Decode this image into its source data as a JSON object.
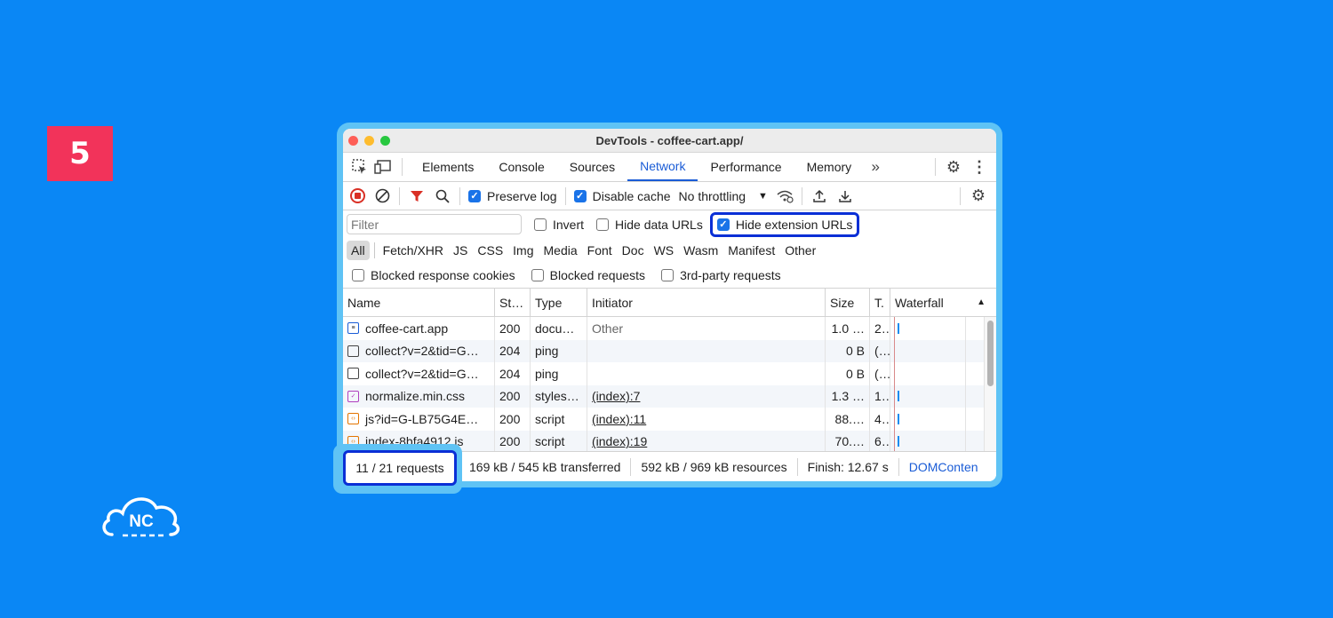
{
  "step": "5",
  "logo_text": "NC",
  "window": {
    "title": "DevTools - coffee-cart.app/"
  },
  "tabs": [
    {
      "label": "Elements"
    },
    {
      "label": "Console"
    },
    {
      "label": "Sources"
    },
    {
      "label": "Network"
    },
    {
      "label": "Performance"
    },
    {
      "label": "Memory"
    }
  ],
  "active_tab": "Network",
  "toolbar": {
    "preserve_log": "Preserve log",
    "disable_cache": "Disable cache",
    "throttling": "No throttling"
  },
  "filter": {
    "placeholder": "Filter",
    "invert": "Invert",
    "hide_data_urls": "Hide data URLs",
    "hide_extension_urls": "Hide extension URLs"
  },
  "type_filters": [
    "All",
    "Fetch/XHR",
    "JS",
    "CSS",
    "Img",
    "Media",
    "Font",
    "Doc",
    "WS",
    "Wasm",
    "Manifest",
    "Other"
  ],
  "blocked": {
    "response_cookies": "Blocked response cookies",
    "requests": "Blocked requests",
    "third_party": "3rd-party requests"
  },
  "columns": {
    "name": "Name",
    "status": "St…",
    "type": "Type",
    "initiator": "Initiator",
    "size": "Size",
    "time": "T.",
    "waterfall": "Waterfall"
  },
  "rows": [
    {
      "name": "coffee-cart.app",
      "status": "200",
      "type": "docu…",
      "initiator": "Other",
      "size": "1.0 …",
      "time": "2…"
    },
    {
      "name": "collect?v=2&tid=G…",
      "status": "204",
      "type": "ping",
      "initiator": "",
      "size": "0 B",
      "time": "(…"
    },
    {
      "name": "collect?v=2&tid=G…",
      "status": "204",
      "type": "ping",
      "initiator": "",
      "size": "0 B",
      "time": "(…"
    },
    {
      "name": "normalize.min.css",
      "status": "200",
      "type": "styles…",
      "initiator": "(index):7",
      "size": "1.3 …",
      "time": "1…"
    },
    {
      "name": "js?id=G-LB75G4E…",
      "status": "200",
      "type": "script",
      "initiator": "(index):11",
      "size": "88.…",
      "time": "4…"
    },
    {
      "name": "index-8bfa4912.js",
      "status": "200",
      "type": "script",
      "initiator": "(index):19",
      "size": "70.…",
      "time": "6…"
    }
  ],
  "status": {
    "requests": "11 / 21 requests",
    "transferred": "169 kB / 545 kB transferred",
    "resources": "592 kB / 969 kB resources",
    "finish": "Finish: 12.67 s",
    "domcontent": "DOMConten"
  }
}
